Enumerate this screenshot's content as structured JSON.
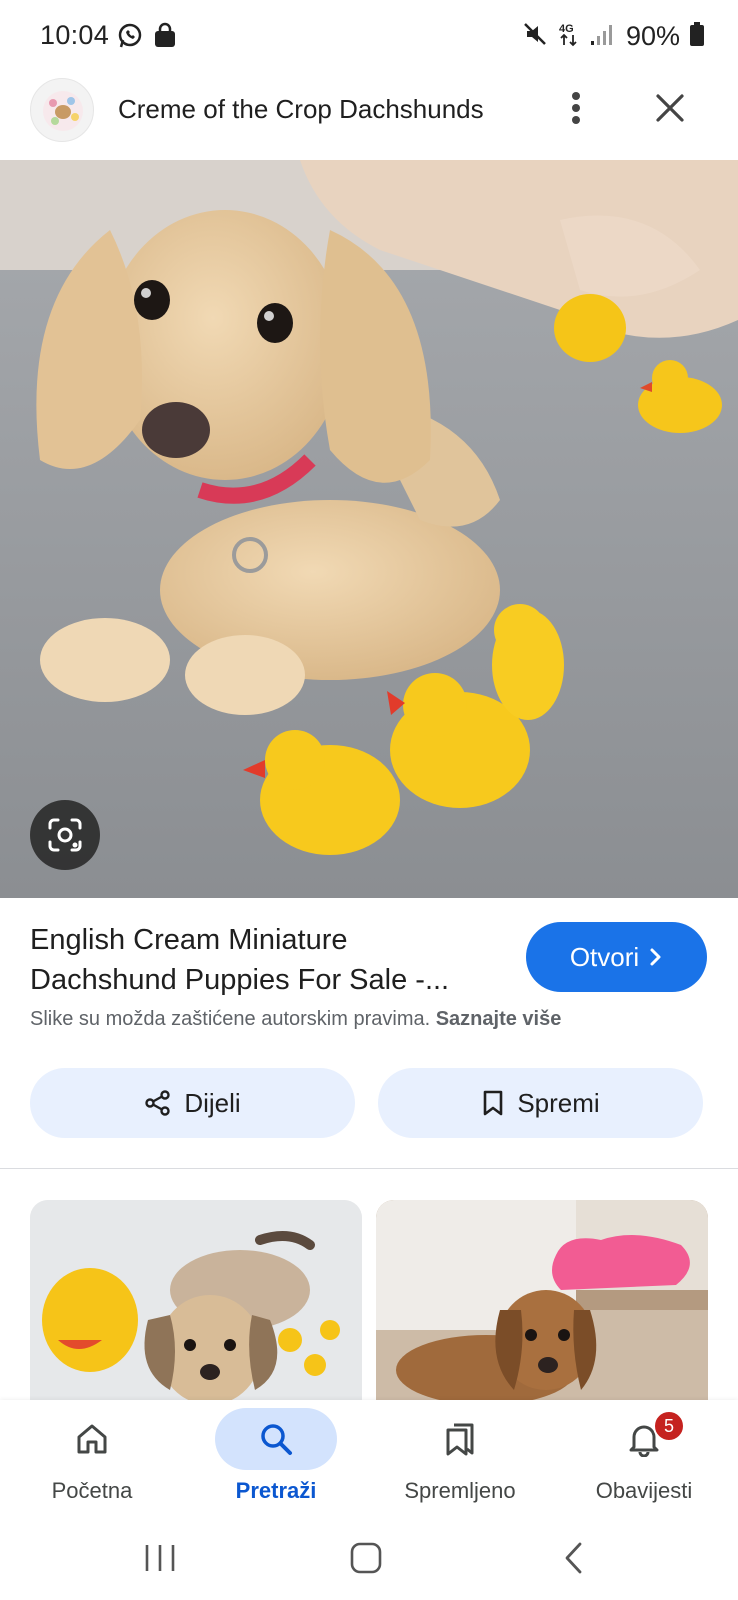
{
  "status_bar": {
    "time": "10:04",
    "battery": "90%",
    "network": "4G",
    "icons": [
      "whatsapp-icon",
      "shopping-bag-icon",
      "mute-icon",
      "4g-icon",
      "signal-icon",
      "battery-icon"
    ]
  },
  "header": {
    "title": "Creme of the Crop Dachshunds",
    "favicon": "site-logo",
    "more_icon": "more-vert-icon",
    "close_icon": "close-icon"
  },
  "hero": {
    "lens_icon": "google-lens-icon"
  },
  "result": {
    "title": "English Cream Miniature Dachshund Puppies For Sale -...",
    "open_label": "Otvori",
    "copyright_text": "Slike su možda zaštićene autorskim pravima.",
    "learn_more": "Saznajte više"
  },
  "actions": {
    "share_label": "Dijeli",
    "save_label": "Spremi"
  },
  "bottom_nav": {
    "items": [
      {
        "label": "Početna",
        "icon": "home-icon"
      },
      {
        "label": "Pretraži",
        "icon": "search-icon",
        "active": true
      },
      {
        "label": "Spremljeno",
        "icon": "saved-icon"
      },
      {
        "label": "Obavijesti",
        "icon": "bell-icon",
        "badge": "5"
      }
    ]
  },
  "colors": {
    "accent": "#1a73e8",
    "active_pill": "#d3e3fd",
    "action_button_bg": "#e8f0fe",
    "badge": "#c5221f"
  }
}
